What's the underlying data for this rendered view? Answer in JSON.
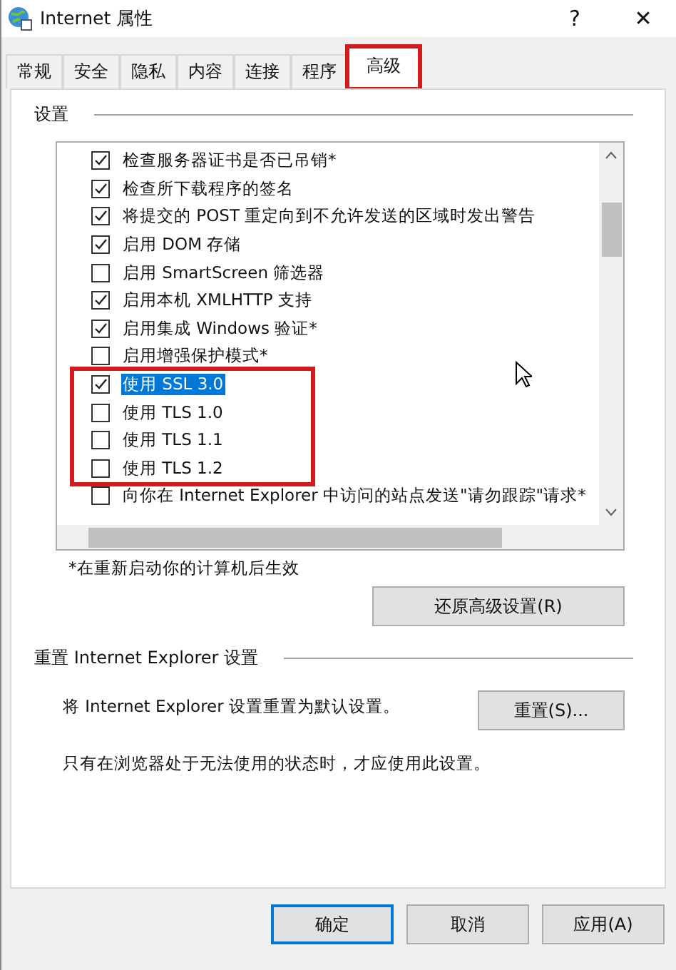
{
  "window": {
    "title": "Internet 属性",
    "help": "?",
    "close": "✕"
  },
  "tabs": [
    {
      "label": "常规",
      "selected": false,
      "highlighted": false
    },
    {
      "label": "安全",
      "selected": false,
      "highlighted": false
    },
    {
      "label": "隐私",
      "selected": false,
      "highlighted": false
    },
    {
      "label": "内容",
      "selected": false,
      "highlighted": false
    },
    {
      "label": "连接",
      "selected": false,
      "highlighted": false
    },
    {
      "label": "程序",
      "selected": false,
      "highlighted": false
    },
    {
      "label": "高级",
      "selected": true,
      "highlighted": true
    }
  ],
  "settings": {
    "heading": "设置",
    "items": [
      {
        "label": "检查服务器证书是否已吊销*",
        "checked": true,
        "selected": false,
        "highlighted": false
      },
      {
        "label": "检查所下载程序的签名",
        "checked": true,
        "selected": false,
        "highlighted": false
      },
      {
        "label": "将提交的 POST 重定向到不允许发送的区域时发出警告",
        "checked": true,
        "selected": false,
        "highlighted": false
      },
      {
        "label": "启用 DOM 存储",
        "checked": true,
        "selected": false,
        "highlighted": false
      },
      {
        "label": "启用 SmartScreen 筛选器",
        "checked": false,
        "selected": false,
        "highlighted": false
      },
      {
        "label": "启用本机 XMLHTTP 支持",
        "checked": true,
        "selected": false,
        "highlighted": false
      },
      {
        "label": "启用集成 Windows 验证*",
        "checked": true,
        "selected": false,
        "highlighted": false
      },
      {
        "label": "启用增强保护模式*",
        "checked": false,
        "selected": false,
        "highlighted": false
      },
      {
        "label": "使用 SSL 3.0",
        "checked": true,
        "selected": true,
        "highlighted": true
      },
      {
        "label": "使用 TLS 1.0",
        "checked": false,
        "selected": false,
        "highlighted": true
      },
      {
        "label": "使用 TLS 1.1",
        "checked": false,
        "selected": false,
        "highlighted": true
      },
      {
        "label": "使用 TLS 1.2",
        "checked": false,
        "selected": false,
        "highlighted": true
      },
      {
        "label": "向你在 Internet Explorer 中访问的站点发送\"请勿跟踪\"请求*",
        "checked": false,
        "selected": false,
        "highlighted": false
      }
    ],
    "footnote": "*在重新启动你的计算机后生效",
    "restore_button": "还原高级设置(R)"
  },
  "reset": {
    "heading": "重置 Internet Explorer 设置",
    "description": "将 Internet Explorer 设置重置为默认设置。",
    "button": "重置(S)...",
    "note": "只有在浏览器处于无法使用的状态时，才应使用此设置。"
  },
  "buttons": [
    {
      "label": "确定",
      "default": true
    },
    {
      "label": "取消",
      "default": false
    },
    {
      "label": "应用(A)",
      "default": false
    }
  ]
}
